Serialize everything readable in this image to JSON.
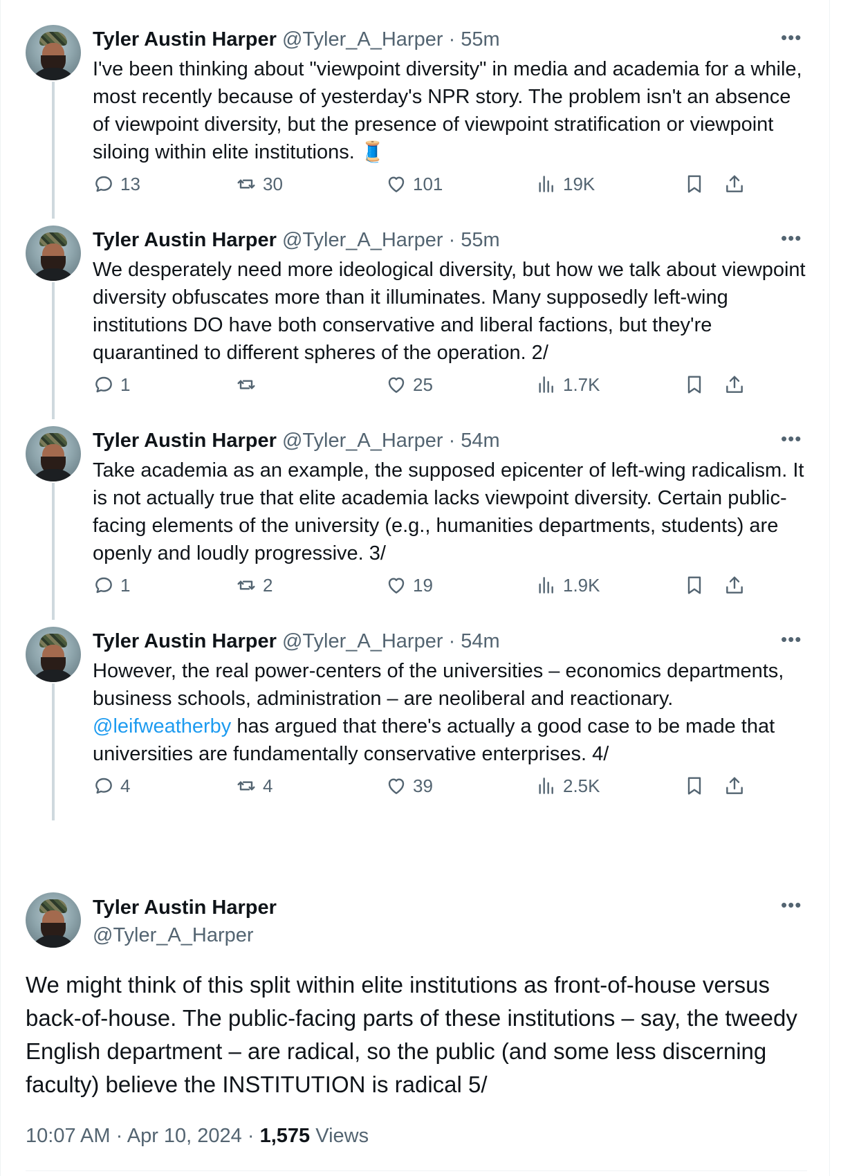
{
  "author": {
    "name": "Tyler Austin Harper",
    "handle": "@Tyler_A_Harper"
  },
  "thread": [
    {
      "time": "55m",
      "text": "I've been thinking about \"viewpoint diversity\" in media and academia for a while, most recently because of yesterday's NPR story. The problem isn't an absence of viewpoint diversity, but the presence of viewpoint stratification or viewpoint siloing within elite institutions. 🧵",
      "replies": "13",
      "reposts": "30",
      "likes": "101",
      "views": "19K"
    },
    {
      "time": "55m",
      "text": "We desperately need more ideological diversity, but how we talk about viewpoint diversity obfuscates more than it illuminates. Many supposedly left-wing institutions DO have both conservative and liberal factions, but they're quarantined to different spheres of the operation. 2/",
      "replies": "1",
      "reposts": "",
      "likes": "25",
      "views": "1.7K"
    },
    {
      "time": "54m",
      "text": "Take academia as an example, the supposed epicenter of left-wing radicalism. It is not actually true that elite academia lacks viewpoint diversity. Certain public-facing elements of the university (e.g., humanities departments, students) are openly and loudly progressive. 3/",
      "replies": "1",
      "reposts": "2",
      "likes": "19",
      "views": "1.9K"
    },
    {
      "time": "54m",
      "text_before": "However, the real power-centers of the universities – economics departments, business schools, administration – are neoliberal and reactionary. ",
      "mention": "@leifweatherby",
      "text_after": " has argued that there's actually a good case to be made that universities are fundamentally conservative enterprises. 4/",
      "replies": "4",
      "reposts": "4",
      "likes": "39",
      "views": "2.5K"
    }
  ],
  "main_tweet": {
    "text": "We might think of this split within elite institutions as front-of-house versus back-of-house. The public-facing parts of these institutions – say, the tweedy English department – are radical, so the public (and some less discerning faculty) believe the INSTITUTION is radical 5/",
    "time": "10:07 AM",
    "date": "Apr 10, 2024",
    "views_count": "1,575",
    "views_label": "Views"
  },
  "ui": {
    "separator": "·",
    "more": "•••"
  },
  "colors": {
    "text": "#0f1419",
    "secondary": "#536471",
    "link": "#1d9bf0",
    "thread_line": "#cfd9de"
  }
}
